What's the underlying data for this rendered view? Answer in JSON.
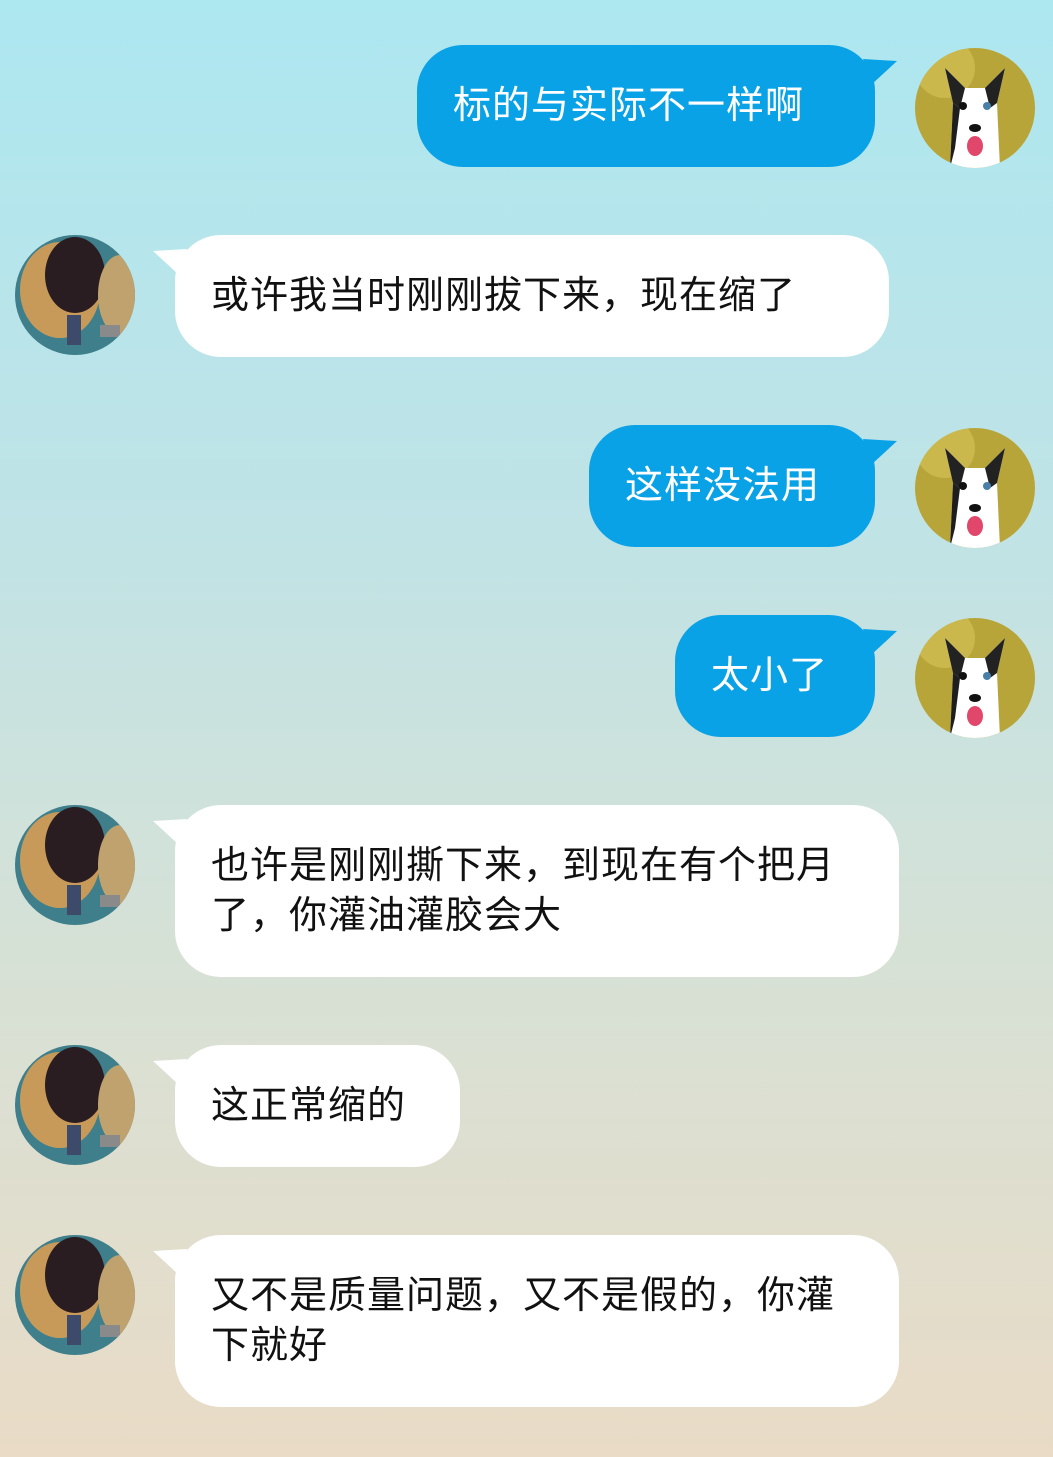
{
  "chat": {
    "messages": [
      {
        "sender": "me",
        "text": "标的与实际不一样啊"
      },
      {
        "sender": "them",
        "text": "或许我当时刚刚拔下来，现在缩了"
      },
      {
        "sender": "me",
        "text": "这样没法用"
      },
      {
        "sender": "me",
        "text": "太小了"
      },
      {
        "sender": "them",
        "text": "也许是刚刚撕下来，到现在有个把月了，你灌油灌胶会大"
      },
      {
        "sender": "them",
        "text": "这正常缩的"
      },
      {
        "sender": "them",
        "text": "又不是质量问题，又不是假的，你灌下就好"
      }
    ]
  },
  "colors": {
    "my_bubble": "#0aa2e6",
    "their_bubble": "#ffffff",
    "my_text": "#ffffff",
    "their_text": "#111111"
  },
  "avatars": {
    "me": "husky-dog-avatar",
    "them": "ping-pong-paddles-avatar"
  }
}
